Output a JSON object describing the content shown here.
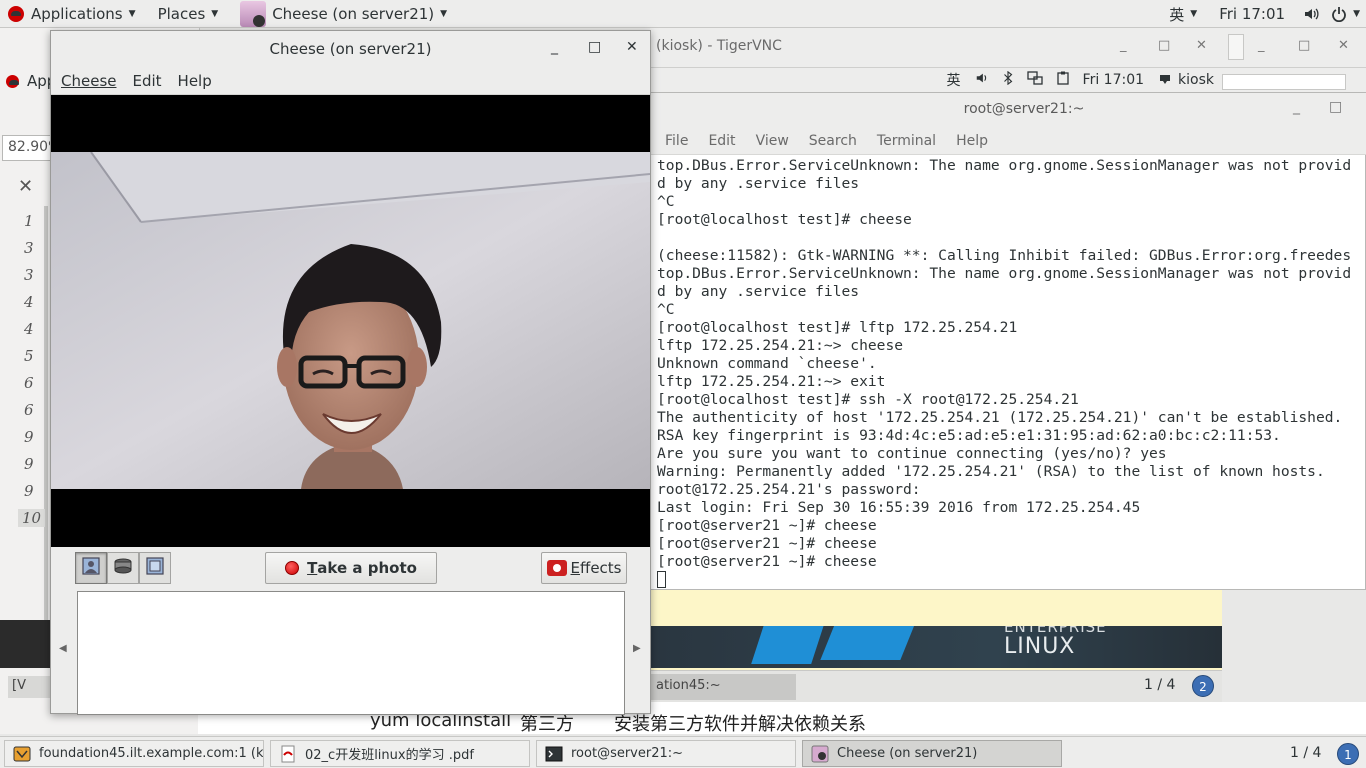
{
  "top_panel": {
    "applications": "Applications",
    "places": "Places",
    "active_window": "Cheese (on server21)",
    "input_method": "英",
    "clock": "Fri 17:01"
  },
  "background_editor": {
    "zoom": "82.90%",
    "line_numbers": [
      "1",
      "3",
      "3",
      "4",
      "4",
      "5",
      "6",
      "6",
      "9",
      "9",
      "9",
      "10"
    ],
    "tab_label": "[V",
    "app_fragment": "App"
  },
  "vnc_window": {
    "title": "(kiosk) - TigerVNC",
    "inner_input_method": "英",
    "inner_clock": "Fri 17:01",
    "inner_user": "kiosk"
  },
  "terminal": {
    "title": "root@server21:~",
    "menu": [
      "File",
      "Edit",
      "View",
      "Search",
      "Terminal",
      "Help"
    ],
    "lines": [
      "top.DBus.Error.ServiceUnknown: The name org.gnome.SessionManager was not provid",
      "d by any .service files",
      "^C",
      "[root@localhost test]# cheese",
      "",
      "(cheese:11582): Gtk-WARNING **: Calling Inhibit failed: GDBus.Error:org.freedes",
      "top.DBus.Error.ServiceUnknown: The name org.gnome.SessionManager was not provid",
      "d by any .service files",
      "^C",
      "[root@localhost test]# lftp 172.25.254.21",
      "lftp 172.25.254.21:~> cheese",
      "Unknown command `cheese'.",
      "lftp 172.25.254.21:~> exit",
      "[root@localhost test]# ssh -X root@172.25.254.21",
      "The authenticity of host '172.25.254.21 (172.25.254.21)' can't be established.",
      "RSA key fingerprint is 93:4d:4c:e5:ad:e5:e1:31:95:ad:62:a0:bc:c2:11:53.",
      "Are you sure you want to continue connecting (yes/no)? yes",
      "Warning: Permanently added '172.25.254.21' (RSA) to the list of known hosts.",
      "root@172.25.254.21's password:",
      "Last login: Fri Sep 30 16:55:39 2016 from 172.25.254.45",
      "[root@server21 ~]# cheese",
      "[root@server21 ~]# cheese",
      "[root@server21 ~]# cheese"
    ]
  },
  "pdf_viewer": {
    "rhel_enterprise": "ENTERPRISE",
    "rhel_linux": "LINUX",
    "tab_label": "ation45:~",
    "page_indicator": "1 / 4",
    "page_badge": "2"
  },
  "caption": {
    "part1": "yum localinstall",
    "part2": "第三方",
    "part3": "安装第三方软件并解决依赖关系"
  },
  "cheese": {
    "title": "Cheese (on server21)",
    "menu": {
      "cheese": "Cheese",
      "edit": "Edit",
      "help": "Help"
    },
    "take_photo_prefix": "T",
    "take_photo_rest": "ake a photo",
    "effects_prefix": "E",
    "effects_rest": "ffects"
  },
  "taskbar": {
    "tasks": [
      "foundation45.ilt.example.com:1 (k...",
      "02_c开发班linux的学习 .pdf",
      "root@server21:~",
      "Cheese (on server21)"
    ],
    "workspace": "1 / 4",
    "workspace_badge": "1"
  },
  "colors": {
    "panel_bg": "#ededec",
    "accent_red": "#cc0000",
    "workspace_blue": "#3c6eb4",
    "rhel_blue": "#1f8fd6"
  }
}
